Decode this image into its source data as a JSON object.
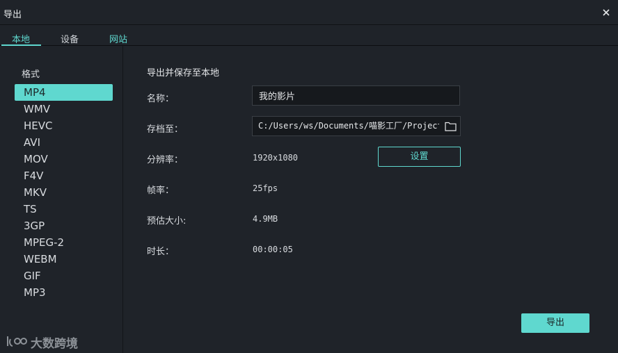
{
  "window": {
    "title": "导出"
  },
  "tabs": [
    {
      "label": "本地",
      "state": "active"
    },
    {
      "label": "设备",
      "state": "inactive"
    },
    {
      "label": "网站",
      "state": "link"
    }
  ],
  "sidebar": {
    "format_label": "格式",
    "formats": [
      "MP4",
      "WMV",
      "HEVC",
      "AVI",
      "MOV",
      "F4V",
      "MKV",
      "TS",
      "3GP",
      "MPEG-2",
      "WEBM",
      "GIF",
      "MP3"
    ],
    "selected": "MP4"
  },
  "panel": {
    "title": "导出并保存至本地",
    "name_label": "名称：",
    "name_value": "我的影片",
    "path_label": "存档至：",
    "path_value": "C:/Users/ws/Documents/喵影工厂/Project",
    "resolution_label": "分辨率：",
    "resolution_value": "1920x1080",
    "settings_button": "设置",
    "framerate_label": "帧率：",
    "framerate_value": "25fps",
    "size_label": "预估大小:",
    "size_value": "4.9MB",
    "duration_label": "时长：",
    "duration_value": "00:00:05"
  },
  "actions": {
    "export_button": "导出"
  },
  "watermark": {
    "text": "大数跨境",
    "icon": "brand-logo-icon"
  },
  "colors": {
    "accent": "#5fd8cf",
    "background": "#1f2329",
    "input_bg": "#16191d"
  },
  "icons": {
    "close": "close-icon",
    "folder": "folder-icon"
  }
}
